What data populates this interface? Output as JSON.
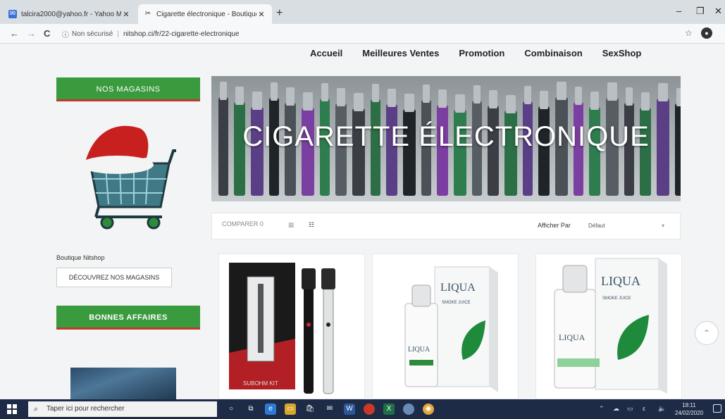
{
  "browser": {
    "tabs": [
      {
        "label": "talcira2000@yahoo.fr - Yahoo M",
        "close": "✕"
      },
      {
        "label": "Cigarette électronique - Boutique",
        "close": "✕"
      }
    ],
    "new_tab": "+",
    "window_controls": {
      "minimize": "–",
      "maximize": "❐",
      "close": "✕"
    },
    "nav": {
      "back": "←",
      "forward": "→",
      "reload": "C"
    },
    "security": "Non sécurisé",
    "url": "nitshop.ci/fr/22-cigarette-electronique",
    "bookmark": "☆",
    "profile": "●"
  },
  "site": {
    "nav": [
      "Accueil",
      "Meilleures Ventes",
      "Promotion",
      "Combinaison",
      "SexShop"
    ],
    "sidebar": {
      "stores_banner": "NOS MAGASINS",
      "store_label": "Boutique Nitshop",
      "discover_button": "DÉCOUVREZ NOS MAGASINS",
      "deals_banner": "BONNES AFFAIRES"
    },
    "hero_title": "CIGARETTE ÉLECTRONIQUE",
    "toolbar": {
      "compare": "COMPARER 0",
      "sort_label": "Afficher Par",
      "sort_value": "Défaut"
    },
    "products": [
      {
        "brand": "",
        "label": "SUBOHM KIT"
      },
      {
        "brand": "LIQUA",
        "label": "SMOKE JUICE"
      },
      {
        "brand": "LIQUA",
        "label": "SMOKE JUICE"
      }
    ],
    "scroll_top": "⌃"
  },
  "taskbar": {
    "search_placeholder": "Taper ici pour rechercher",
    "time": "18:11",
    "date": "24/02/2020"
  },
  "colors": {
    "banner_green": "#3a9a3e",
    "banner_red_underline": "#c0392b",
    "taskbar": "#1e2b46"
  }
}
